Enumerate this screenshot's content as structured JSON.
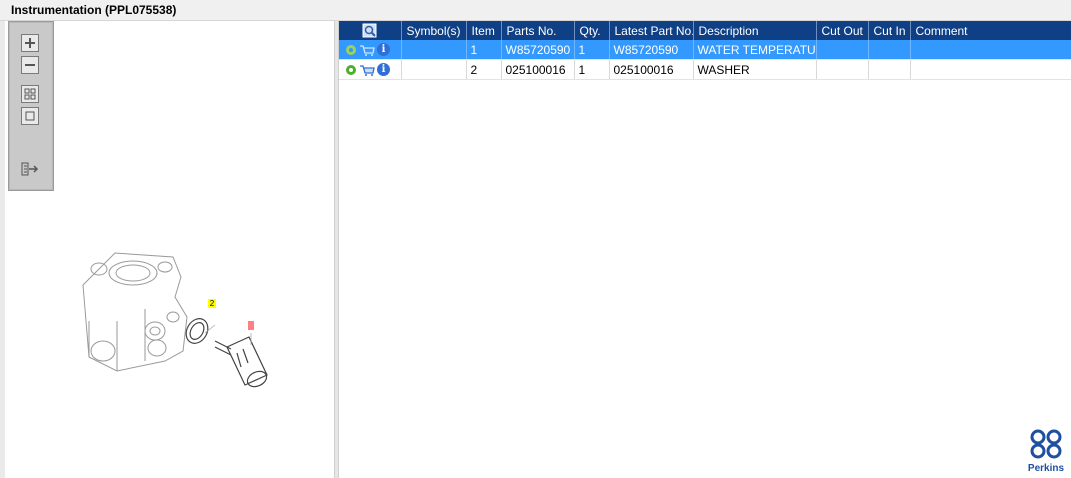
{
  "window": {
    "title": "Instrumentation (PPL075538)"
  },
  "toolbar": {
    "buttons": [
      {
        "name": "zoom-in-button",
        "icon": "plus-icon"
      },
      {
        "name": "zoom-out-button",
        "icon": "minus-icon"
      },
      {
        "name": "fit-all-button",
        "icon": "grid-icon"
      },
      {
        "name": "fit-page-button",
        "icon": "square-icon"
      },
      {
        "name": "export-button",
        "icon": "export-arrow-icon"
      }
    ]
  },
  "illustration": {
    "callouts": [
      {
        "label": "2",
        "color": "#ffff00"
      },
      {
        "label": "1",
        "color": "#ff8080"
      }
    ]
  },
  "table": {
    "headers": [
      "",
      "Symbol(s)",
      "Item",
      "Parts No.",
      "Qty.",
      "Latest Part No.",
      "Description",
      "Cut Out",
      "Cut In",
      "Comment"
    ],
    "rows": [
      {
        "selected": true,
        "item": "1",
        "parts_no": "W85720590",
        "qty": "1",
        "latest_part_no": "W85720590",
        "description": "WATER TEMPERATURE S",
        "cut_out": "",
        "cut_in": "",
        "comment": ""
      },
      {
        "selected": false,
        "item": "2",
        "parts_no": "025100016",
        "qty": "1",
        "latest_part_no": "025100016",
        "description": "WASHER",
        "cut_out": "",
        "cut_in": "",
        "comment": ""
      }
    ]
  },
  "colors": {
    "header_bg": "#0f3f84",
    "selected_row": "#3399ff",
    "brand": "#1f4fa0"
  },
  "brand": {
    "name": "Perkins"
  }
}
